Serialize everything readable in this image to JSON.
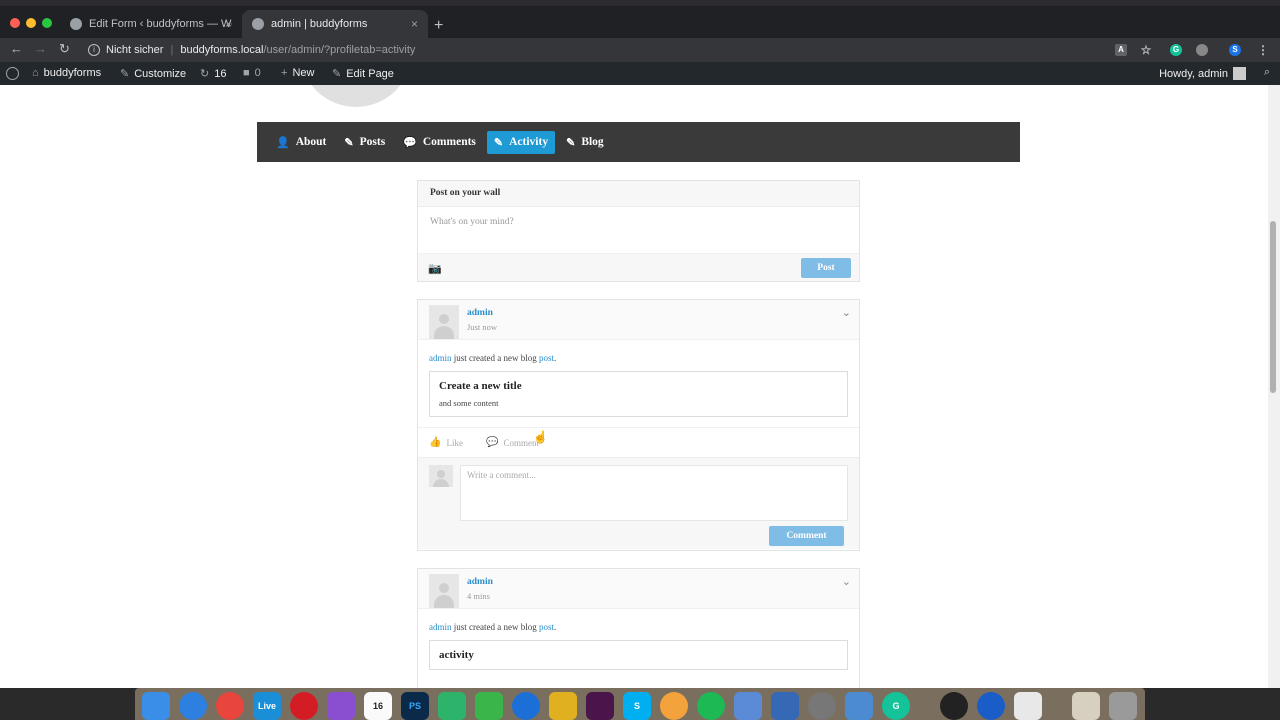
{
  "browser": {
    "tabs": [
      {
        "title": "Edit Form ‹ buddyforms — Wo",
        "active": false
      },
      {
        "title": "admin | buddyforms",
        "active": true
      }
    ],
    "new_tab": "+",
    "close": "×",
    "security_label": "Nicht sicher",
    "url_host": "buddyforms.local",
    "url_path": "/user/admin/?profiletab=activity",
    "profile_initial": "S",
    "grammarly_initial": "G"
  },
  "wp_admin_bar": {
    "site_name": "buddyforms",
    "customize": "Customize",
    "updates_count": "16",
    "comments_count": "0",
    "new_label": "New",
    "edit_page": "Edit Page",
    "howdy": "Howdy, admin"
  },
  "profile_nav": {
    "items": [
      {
        "label": "About",
        "icon": "user-icon",
        "glyph": "👤"
      },
      {
        "label": "Posts",
        "icon": "pencil-icon",
        "glyph": "✎"
      },
      {
        "label": "Comments",
        "icon": "comment-bubble-icon",
        "glyph": "💬"
      },
      {
        "label": "Activity",
        "icon": "edit-square-icon",
        "glyph": "✎"
      },
      {
        "label": "Blog",
        "icon": "pencil-icon",
        "glyph": "✎"
      }
    ],
    "active": "Activity"
  },
  "post_wall": {
    "title": "Post on your wall",
    "placeholder": "What's on your mind?",
    "post_button": "Post"
  },
  "activities": [
    {
      "user": "admin",
      "time": "Just now",
      "text_before": "just created a new blog",
      "link": "post",
      "text_after": ".",
      "embed_title": "Create a new title",
      "embed_body": "and some content",
      "like_label": "Like",
      "comment_label": "Comment",
      "comment_placeholder": "Write a comment...",
      "comment_button": "Comment"
    },
    {
      "user": "admin",
      "time": "4 mins",
      "text_before": "just created a new blog",
      "link": "post",
      "text_after": ".",
      "embed_title": "activity"
    }
  ],
  "dock": {
    "live_label": "Live",
    "calendar_day": "16",
    "ps_label": "PS",
    "skype_label": "S",
    "grammarly_label": "G"
  },
  "colors": {
    "accent": "#1e9bd4",
    "link": "#2a8ec9",
    "button": "#7fbde6",
    "nav_bg": "#3a3a3a",
    "wp_bar": "#23282d"
  }
}
